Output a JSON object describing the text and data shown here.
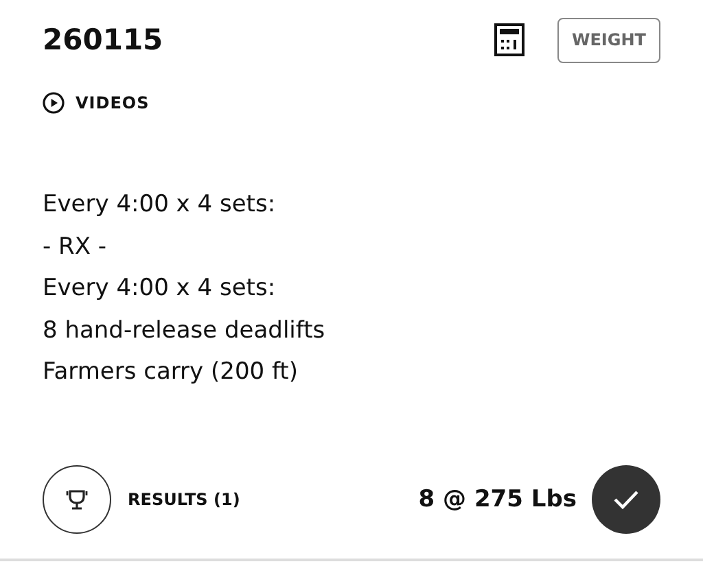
{
  "title": "260115",
  "weight_button": "WEIGHT",
  "videos_link": "VIDEOS",
  "description": [
    "Every 4:00 x 4 sets:",
    "- RX -",
    "Every 4:00 x 4 sets:",
    "8 hand-release deadlifts",
    "Farmers carry (200 ft)"
  ],
  "results_link": "RESULTS (1)",
  "score": "8 @ 275 Lbs"
}
